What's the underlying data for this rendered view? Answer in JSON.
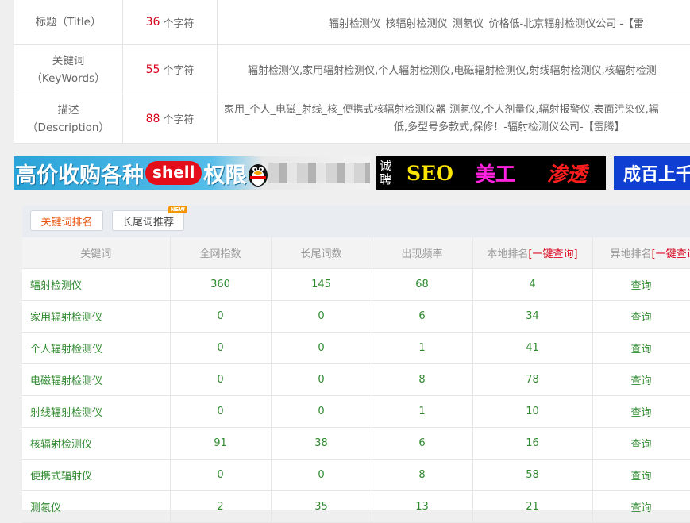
{
  "meta_table": {
    "rows": [
      {
        "label": "标题（Title）",
        "label2": "",
        "count": "36",
        "unit": "个字符",
        "content": "辐射检测仪_核辐射检测仪_测氡仪_价格低-北京辐射检测仪公司 -【雷"
      },
      {
        "label": "关键词",
        "label2": "（KeyWords）",
        "count": "55",
        "unit": "个字符",
        "content": "辐射检测仪,家用辐射检测仪,个人辐射检测仪,电磁辐射检测仪,射线辐射检测仪,核辐射检测"
      },
      {
        "label": "描述",
        "label2": "（Description）",
        "count": "88",
        "unit": "个字符",
        "content": "家用_个人_电磁_射线_核_便携式核辐射检测仪器-测氡仪,个人剂量仪,辐射报警仪,表面污染仪,辐",
        "content2": "低,多型号多款式,保修！-辐射检测仪公司-【雷腾】"
      }
    ]
  },
  "banners": {
    "b1_text1": "高价收购各种",
    "b1_pill": "shell",
    "b1_text2": "权限",
    "b2_small": "诚聘",
    "b2_seo": "SEO",
    "b2_mg": "美工",
    "b2_st": "渗透",
    "b3_text": "成百上千"
  },
  "tabs": {
    "tab1": "关键词排名",
    "tab2": "长尾词推荐",
    "badge": "NEW"
  },
  "table": {
    "headers": [
      "关键词",
      "全网指数",
      "长尾词数",
      "出现频率",
      "本地排名",
      "异地排名"
    ],
    "query_link": "[一键查询]",
    "rows": [
      {
        "kw": "辐射检测仪",
        "index": "360",
        "longtail": "145",
        "freq": "68",
        "local": "4",
        "remote": "查询"
      },
      {
        "kw": "家用辐射检测仪",
        "index": "0",
        "longtail": "0",
        "freq": "6",
        "local": "34",
        "remote": "查询"
      },
      {
        "kw": "个人辐射检测仪",
        "index": "0",
        "longtail": "0",
        "freq": "1",
        "local": "41",
        "remote": "查询"
      },
      {
        "kw": "电磁辐射检测仪",
        "index": "0",
        "longtail": "0",
        "freq": "8",
        "local": "78",
        "remote": "查询"
      },
      {
        "kw": "射线辐射检测仪",
        "index": "0",
        "longtail": "0",
        "freq": "1",
        "local": "10",
        "remote": "查询"
      },
      {
        "kw": "核辐射检测仪",
        "index": "91",
        "longtail": "38",
        "freq": "6",
        "local": "16",
        "remote": "查询"
      },
      {
        "kw": "便携式辐射仪",
        "index": "0",
        "longtail": "0",
        "freq": "8",
        "local": "58",
        "remote": "查询"
      },
      {
        "kw": "测氡仪",
        "index": "2",
        "longtail": "35",
        "freq": "13",
        "local": "21",
        "remote": "查询"
      }
    ]
  }
}
